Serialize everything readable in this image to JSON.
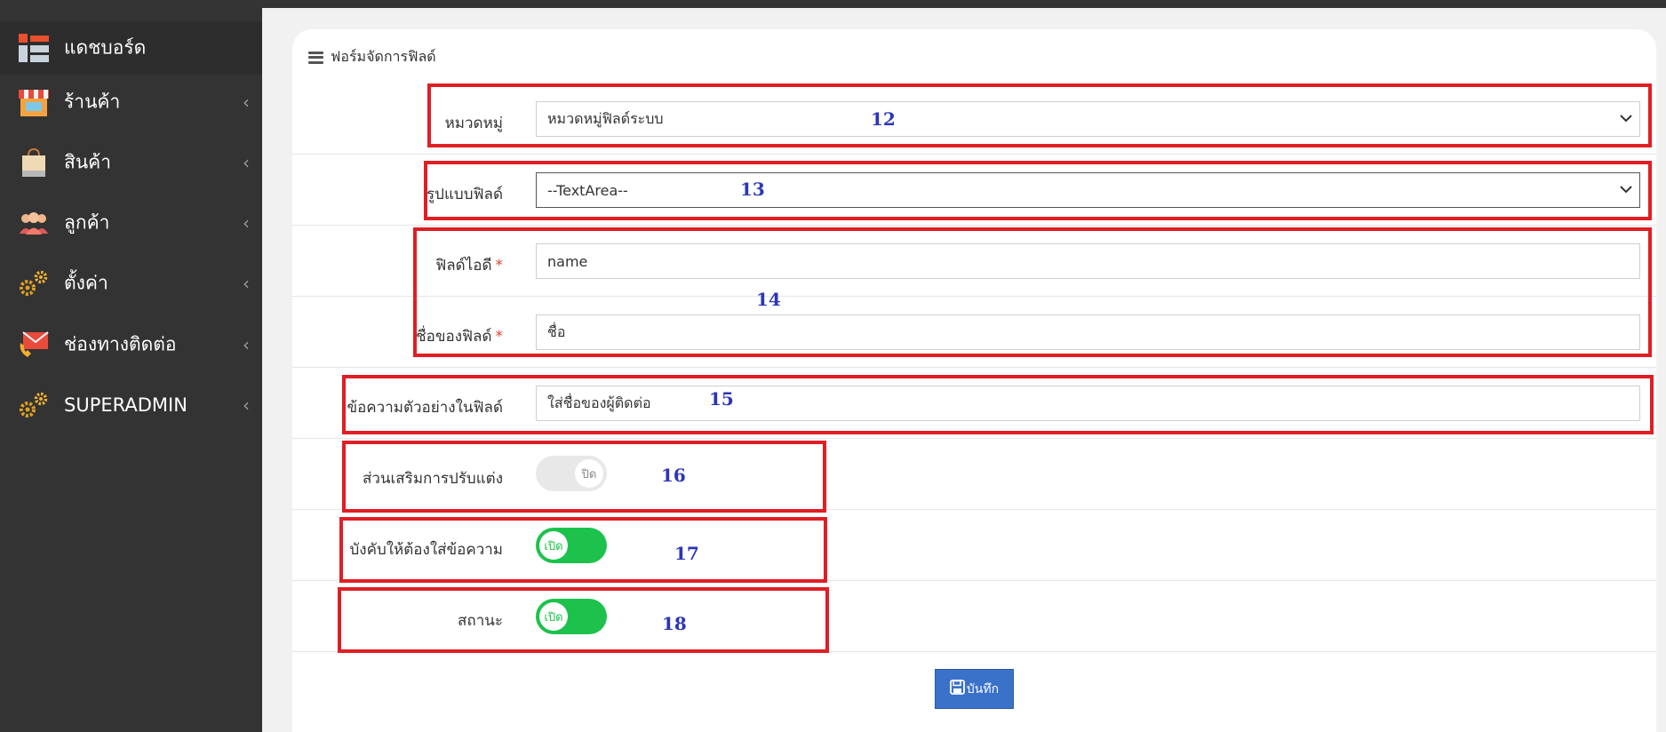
{
  "sidebar": {
    "items": [
      {
        "label": "แดชบอร์ด",
        "icon": "dashboard-icon"
      },
      {
        "label": "ร้านค้า",
        "icon": "store-icon"
      },
      {
        "label": "สินค้า",
        "icon": "shopping-bag-icon"
      },
      {
        "label": "ลูกค้า",
        "icon": "customers-icon"
      },
      {
        "label": "ตั้งค่า",
        "icon": "gears-icon"
      },
      {
        "label": "ช่องทางติดต่อ",
        "icon": "contact-icon"
      },
      {
        "label": "SUPERADMIN",
        "icon": "gears-icon"
      }
    ],
    "chevron": "‹"
  },
  "form": {
    "title": "ฟอร์มจัดการฟิลด์",
    "category_label": "หมวดหมู่",
    "category_value": "หมวดหมู่ฟิลด์ระบบ",
    "type_label": "รูปแบบฟิลด์",
    "type_value": "--TextArea--",
    "field_id_label": "ฟิลด์ไอดี",
    "field_id_value": "name",
    "field_name_label": "ชื่อของฟิลด์",
    "field_name_value": "ชื่อ",
    "placeholder_label": "ข้อความตัวอย่างในฟิลด์",
    "placeholder_value": "ใส่ชื่อของผู้ติดต่อ",
    "custom_label": "ส่วนเสริมการปรับแต่ง",
    "custom_toggle": "ปิด",
    "required_label": "บังคับให้ต้องใส่ข้อความ",
    "required_toggle": "เปิด",
    "status_label": "สถานะ",
    "status_toggle": "เปิด",
    "required_mark": "*",
    "save_label": "บันทึก"
  },
  "annotations": [
    "12",
    "13",
    "14",
    "15",
    "16",
    "17",
    "18"
  ],
  "colors": {
    "sidebar_bg": "#333333",
    "annotation_box": "#e01e24",
    "annotation_number": "#2c35b8",
    "toggle_on": "#1cc24c",
    "save_button": "#3a71c9"
  }
}
